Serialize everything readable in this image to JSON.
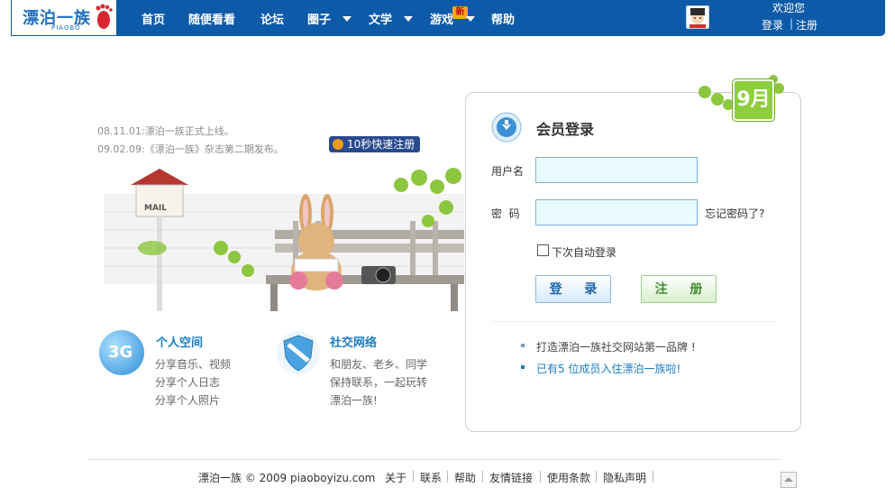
{
  "nav": {
    "logo_text": "漂泊一族",
    "logo_sub": "PIAOBO",
    "items": [
      {
        "label": "首页"
      },
      {
        "label": "随便看看"
      },
      {
        "label": "论坛"
      },
      {
        "label": "圈子"
      },
      {
        "label": "文学"
      },
      {
        "label": "游戏"
      },
      {
        "label": "帮助"
      }
    ],
    "new_badge": "新",
    "welcome": "欢迎您",
    "login_link": "登录",
    "register_link": "注册"
  },
  "news": [
    "08.11.01:漂泊一族正式上线。",
    "09.02.09:《漂泊一族》杂志第二期发布。"
  ],
  "quick_register": "10秒快速注册",
  "scene": {
    "mailbox_label": "MAIL"
  },
  "features": [
    {
      "icon_text": "3G",
      "title": "个人空间",
      "lines": [
        "分享音乐、视频",
        "分享个人日志",
        "分享个人照片"
      ]
    },
    {
      "title": "社交网络",
      "lines": [
        "和朋友、老乡、同学",
        "保持联系，一起玩转",
        "漂泊一族!"
      ]
    }
  ],
  "login": {
    "month_badge": "9月",
    "title": "会员登录",
    "username_label": "用户名",
    "password_label": "密  码",
    "forgot": "忘记密码了?",
    "remember": "下次自动登录",
    "login_button": "登 录",
    "register_button": "注 册",
    "tips": [
      "打造漂泊一族社交网站第一品牌 !",
      "已有5 位成员入住漂泊一族啦!"
    ]
  },
  "footer": {
    "copyright": "漂泊一族 © 2009 piaoboyizu.com",
    "links": [
      "关于",
      "联系",
      "帮助",
      "友情链接",
      "使用条款",
      "隐私声明"
    ]
  },
  "colors": {
    "nav_bg": "#0d5aa8",
    "accent": "#1a7dc4",
    "input_bg": "#eafbff"
  }
}
